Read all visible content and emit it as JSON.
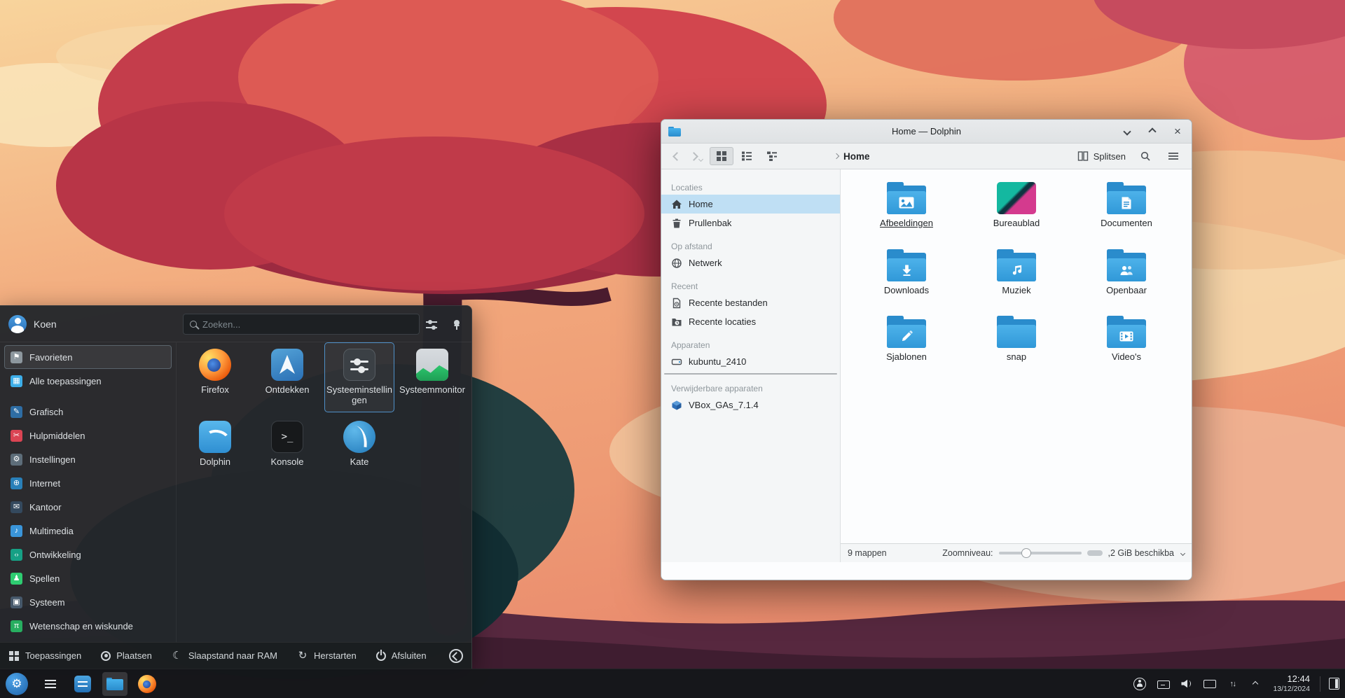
{
  "accent_color": "#3daee9",
  "glyphs": {
    "close": "×",
    "konsole_prompt": ">_",
    "network_arrows": "↑↓",
    "moon": "☾",
    "restart": "↻",
    "gear": "⚙"
  },
  "icons": {
    "search": "magnifier",
    "configure": "sliders",
    "pin": "pushpin",
    "kde-logo": "gear-in-circle",
    "window-controls": [
      "minimize-chevron-down",
      "maximize-chevron-up",
      "close-x"
    ],
    "view-modes": [
      "icons-grid",
      "details-list",
      "tree-list"
    ]
  },
  "launcher": {
    "user_name": "Koen",
    "search": {
      "placeholder": "Zoeken..."
    },
    "sidebar": [
      {
        "label": "Favorieten",
        "icon": "favorites-icon",
        "selected": true
      },
      {
        "label": "Alle toepassingen",
        "icon": "all-apps-icon"
      },
      {
        "label": "Grafisch",
        "icon": "graphics-icon"
      },
      {
        "label": "Hulpmiddelen",
        "icon": "utilities-icon"
      },
      {
        "label": "Instellingen",
        "icon": "settings-icon"
      },
      {
        "label": "Internet",
        "icon": "internet-icon"
      },
      {
        "label": "Kantoor",
        "icon": "office-icon"
      },
      {
        "label": "Multimedia",
        "icon": "multimedia-icon"
      },
      {
        "label": "Ontwikkeling",
        "icon": "development-icon"
      },
      {
        "label": "Spellen",
        "icon": "games-icon"
      },
      {
        "label": "Systeem",
        "icon": "system-icon"
      },
      {
        "label": "Wetenschap en wiskunde",
        "icon": "science-icon"
      }
    ],
    "apps": [
      {
        "label": "Firefox",
        "icon": "firefox-icon"
      },
      {
        "label": "Ontdekken",
        "icon": "discover-icon"
      },
      {
        "label": "Systeeminstellingen",
        "icon": "system-settings-icon",
        "selected": true
      },
      {
        "label": "Systeemmonitor",
        "icon": "system-monitor-icon"
      },
      {
        "label": "Dolphin",
        "icon": "dolphin-icon"
      },
      {
        "label": "Konsole",
        "icon": "konsole-icon"
      },
      {
        "label": "Kate",
        "icon": "kate-icon"
      }
    ],
    "footer": {
      "applications_label": "Toepassingen",
      "places_label": "Plaatsen",
      "sleep_label": "Slaapstand naar RAM",
      "restart_label": "Herstarten",
      "shutdown_label": "Afsluiten"
    }
  },
  "dolphin": {
    "window_title": "Home — Dolphin",
    "toolbar": {
      "breadcrumb": "Home",
      "split_label": "Splitsen"
    },
    "places": [
      {
        "header": "Locaties",
        "items": [
          {
            "label": "Home",
            "icon": "home-icon",
            "selected": true
          },
          {
            "label": "Prullenbak",
            "icon": "trash-icon"
          }
        ]
      },
      {
        "header": "Op afstand",
        "items": [
          {
            "label": "Netwerk",
            "icon": "network-icon"
          }
        ]
      },
      {
        "header": "Recent",
        "items": [
          {
            "label": "Recente bestanden",
            "icon": "recent-files-icon"
          },
          {
            "label": "Recente locaties",
            "icon": "recent-locations-icon"
          }
        ]
      },
      {
        "header": "Apparaten",
        "items": [
          {
            "label": "kubuntu_2410",
            "icon": "drive-icon"
          }
        ]
      },
      {
        "header": "Verwijderbare apparaten",
        "items": [
          {
            "label": "VBox_GAs_7.1.4",
            "icon": "optical-disc-icon"
          }
        ]
      }
    ],
    "folders": [
      {
        "label": "Afbeeldingen",
        "icon": "folder-image-icon"
      },
      {
        "label": "Bureaublad",
        "icon": "folder-desktop-icon"
      },
      {
        "label": "Documenten",
        "icon": "folder-documents-icon"
      },
      {
        "label": "Downloads",
        "icon": "folder-downloads-icon"
      },
      {
        "label": "Muziek",
        "icon": "folder-music-icon"
      },
      {
        "label": "Openbaar",
        "icon": "folder-public-icon"
      },
      {
        "label": "Sjablonen",
        "icon": "folder-templates-icon"
      },
      {
        "label": "snap",
        "icon": "folder-icon"
      },
      {
        "label": "Video's",
        "icon": "folder-videos-icon"
      }
    ],
    "statusbar": {
      "items_count": "9 mappen",
      "zoom_label": "Zoomniveau:",
      "free_space": ",2 GiB beschikba"
    }
  },
  "taskbar": {
    "clock": {
      "time": "12:44",
      "date": "13/12/2024"
    }
  }
}
